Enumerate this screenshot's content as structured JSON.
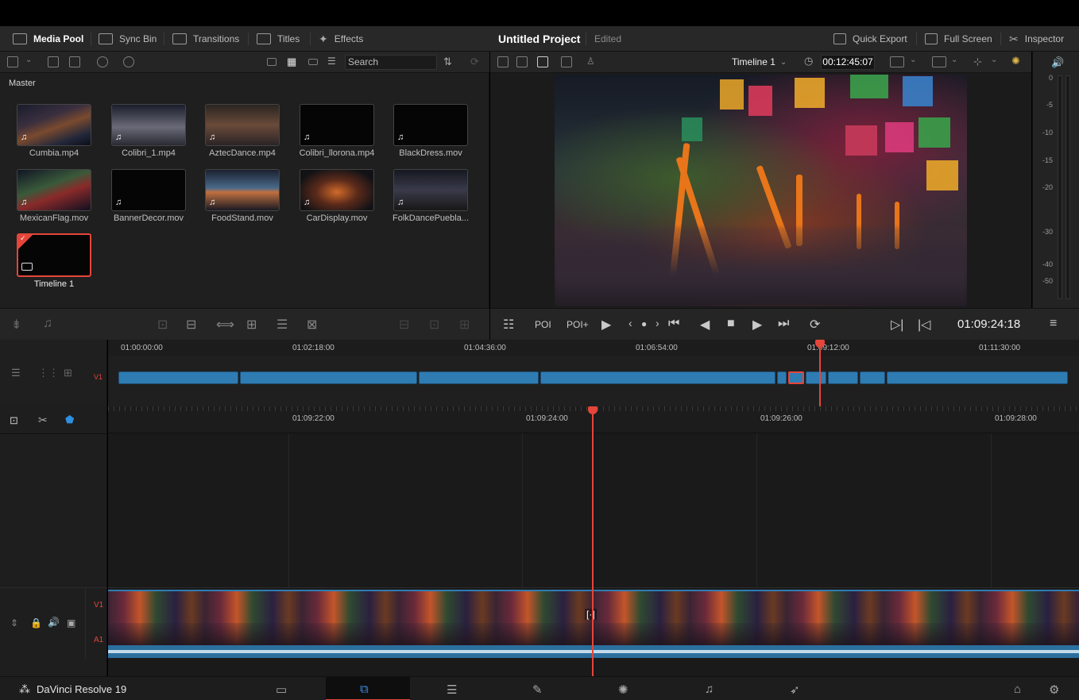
{
  "topbar": {
    "media_pool": "Media Pool",
    "sync_bin": "Sync Bin",
    "transitions": "Transitions",
    "titles": "Titles",
    "effects": "Effects",
    "project_title": "Untitled Project",
    "project_status": "Edited",
    "quick_export": "Quick Export",
    "full_screen": "Full Screen",
    "inspector": "Inspector"
  },
  "pool": {
    "search_placeholder": "Search",
    "bin": "Master",
    "clips": [
      {
        "name": "Cumbia.mp4"
      },
      {
        "name": "Colibri_1.mp4"
      },
      {
        "name": "AztecDance.mp4"
      },
      {
        "name": "Colibri_llorona.mp4"
      },
      {
        "name": "BlackDress.mov"
      },
      {
        "name": "MexicanFlag.mov"
      },
      {
        "name": "BannerDecor.mov"
      },
      {
        "name": "FoodStand.mov"
      },
      {
        "name": "CarDisplay.mov"
      },
      {
        "name": "FolkDancePuebla...."
      },
      {
        "name": "Timeline 1"
      }
    ]
  },
  "viewer": {
    "timeline_name": "Timeline 1",
    "timecode": "00:12:45:07",
    "current_tc": "01:09:24:18"
  },
  "meter": {
    "ticks": [
      "0",
      "-5",
      "-10",
      "-15",
      "-20",
      "-30",
      "-40",
      "-50"
    ]
  },
  "overview": {
    "ruler": [
      "01:00:00:00",
      "01:02:18:00",
      "01:04:36:00",
      "01:06:54:00",
      "01:09:12:00",
      "01:11:30:00"
    ],
    "track": "V1"
  },
  "timeline": {
    "ruler": [
      "01:09:22:00",
      "01:09:24:00",
      "01:09:26:00",
      "01:09:28:00"
    ],
    "v1": "V1",
    "a1": "A1"
  },
  "bottom": {
    "brand": "DaVinci Resolve 19"
  },
  "colors": {
    "accent_red": "#e5453a",
    "clip_blue": "#2f7cb3"
  }
}
